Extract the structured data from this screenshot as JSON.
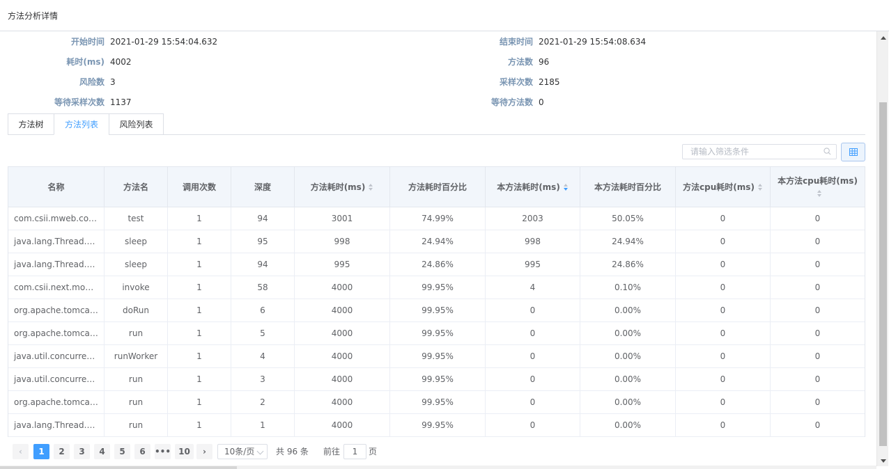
{
  "dialog": {
    "title": "方法分析详情"
  },
  "info": {
    "rows": [
      {
        "left_label": "开始时间",
        "left_value": "2021-01-29 15:54:04.632",
        "right_label": "结束时间",
        "right_value": "2021-01-29 15:54:08.634"
      },
      {
        "left_label": "耗时(ms)",
        "left_value": "4002",
        "right_label": "方法数",
        "right_value": "96"
      },
      {
        "left_label": "风险数",
        "left_value": "3",
        "right_label": "采样次数",
        "right_value": "2185"
      },
      {
        "left_label": "等待采样次数",
        "left_value": "1137",
        "right_label": "等待方法数",
        "right_value": "0"
      }
    ]
  },
  "tabs": [
    {
      "label": "方法树",
      "active": false
    },
    {
      "label": "方法列表",
      "active": true
    },
    {
      "label": "风险列表",
      "active": false
    }
  ],
  "filter": {
    "placeholder": "请输入筛选条件",
    "value": ""
  },
  "table": {
    "columns": [
      {
        "label": "名称",
        "sortable": false
      },
      {
        "label": "方法名",
        "sortable": false
      },
      {
        "label": "调用次数",
        "sortable": false
      },
      {
        "label": "深度",
        "sortable": false
      },
      {
        "label": "方法耗时(ms)",
        "sortable": true,
        "sort": "none"
      },
      {
        "label": "方法耗时百分比",
        "sortable": false
      },
      {
        "label": "本方法耗时(ms)",
        "sortable": true,
        "sort": "descending"
      },
      {
        "label": "本方法耗时百分比",
        "sortable": false
      },
      {
        "label": "方法cpu耗时(ms)",
        "sortable": true,
        "sort": "none"
      },
      {
        "label": "本方法cpu耗时(ms)",
        "sortable": true,
        "sort": "none"
      }
    ],
    "rows": [
      [
        "com.csii.mweb.contr...",
        "test",
        "1",
        "94",
        "3001",
        "74.99%",
        "2003",
        "50.05%",
        "0",
        "0"
      ],
      [
        "java.lang.Thread.sle...",
        "sleep",
        "1",
        "95",
        "998",
        "24.94%",
        "998",
        "24.94%",
        "0",
        "0"
      ],
      [
        "java.lang.Thread.sle...",
        "sleep",
        "1",
        "94",
        "995",
        "24.86%",
        "995",
        "24.86%",
        "0",
        "0"
      ],
      [
        "com.csii.next.monito...",
        "invoke",
        "1",
        "58",
        "4000",
        "99.95%",
        "4",
        "0.10%",
        "0",
        "0"
      ],
      [
        "org.apache.tomcat.u...",
        "doRun",
        "1",
        "6",
        "4000",
        "99.95%",
        "0",
        "0.00%",
        "0",
        "0"
      ],
      [
        "org.apache.tomcat.u...",
        "run",
        "1",
        "5",
        "4000",
        "99.95%",
        "0",
        "0.00%",
        "0",
        "0"
      ],
      [
        "java.util.concurrent....",
        "runWorker",
        "1",
        "4",
        "4000",
        "99.95%",
        "0",
        "0.00%",
        "0",
        "0"
      ],
      [
        "java.util.concurrent....",
        "run",
        "1",
        "3",
        "4000",
        "99.95%",
        "0",
        "0.00%",
        "0",
        "0"
      ],
      [
        "org.apache.tomcat.u...",
        "run",
        "1",
        "2",
        "4000",
        "99.95%",
        "0",
        "0.00%",
        "0",
        "0"
      ],
      [
        "java.lang.Thread.ru...",
        "run",
        "1",
        "1",
        "4000",
        "99.95%",
        "0",
        "0.00%",
        "0",
        "0"
      ]
    ]
  },
  "pagination": {
    "prev": "‹",
    "next": "›",
    "pages": [
      "1",
      "2",
      "3",
      "4",
      "5",
      "6",
      "•••",
      "10"
    ],
    "current": "1",
    "page_size": "10条/页",
    "total_text": "共 96 条",
    "goto_label": "前往",
    "goto_value": "1",
    "page_unit": "页"
  },
  "colors": {
    "accent": "#409eff",
    "label": "#7b96b3",
    "header_bg": "#f2f6fb"
  }
}
